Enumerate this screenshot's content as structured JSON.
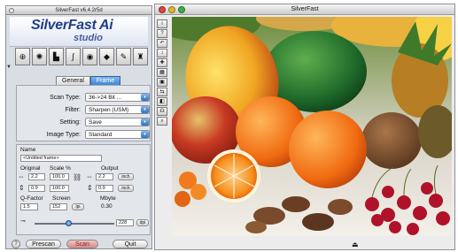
{
  "left_window": {
    "title": "SilverFast v6.4.2r5d",
    "brand": "SilverFast Ai",
    "brand_sub": "studio",
    "tools": [
      {
        "icon": "magnifier-icon",
        "glyph": "⊕"
      },
      {
        "icon": "burst-icon",
        "glyph": "✺"
      },
      {
        "icon": "histogram-icon",
        "glyph": "▙"
      },
      {
        "icon": "gradation-curve-icon",
        "glyph": "∫"
      },
      {
        "icon": "color-wheel-icon",
        "glyph": "◉"
      },
      {
        "icon": "selective-color-icon",
        "glyph": "◆"
      },
      {
        "icon": "brush-icon",
        "glyph": "✎"
      },
      {
        "icon": "cast-removal-icon",
        "glyph": "♜"
      }
    ],
    "tabs": [
      {
        "label": "General",
        "active": false
      },
      {
        "label": "Frame",
        "active": true
      }
    ],
    "scan_type": {
      "label": "Scan Type:",
      "value": "36->24 Bit ..."
    },
    "filter": {
      "label": "Filter:",
      "value": "Sharpen (USM)"
    },
    "setting": {
      "label": "Setting:",
      "value": "Save"
    },
    "image_type": {
      "label": "Image Type:",
      "value": "Standard"
    },
    "frame": {
      "name_label": "Name",
      "name_value": "<Untitled frame>",
      "original_label": "Original",
      "scale_label": "Scale %",
      "output_label": "Output",
      "orig_w": "2.2",
      "scale_w": "100.0",
      "out_w": "2.2",
      "unit_w": "inch",
      "orig_h": "0.9",
      "scale_h": "100.0",
      "out_h": "0.9",
      "unit_h": "inch",
      "qfactor_label": "Q-Factor",
      "screen_label": "Screen",
      "mbyte_label": "Mbyte",
      "qfactor": "1.5",
      "screen": "152",
      "screen_unit": "lpi",
      "mbyte": "0.30",
      "resolution": "228",
      "res_unit": "dpi",
      "slider_pos": 0.42
    },
    "buttons": {
      "prescan": "Prescan",
      "scan": "Scan",
      "quit": "Quit",
      "help": "?"
    }
  },
  "right_window": {
    "title": "SilverFast",
    "toolbar": [
      "i",
      "?",
      "↶",
      "↕",
      "✚",
      "▦",
      "▣",
      "⇆",
      "◧",
      "☊",
      "⌕"
    ]
  },
  "colors": {
    "accent": "#3f86d3",
    "brand": "#1f3d8f"
  }
}
